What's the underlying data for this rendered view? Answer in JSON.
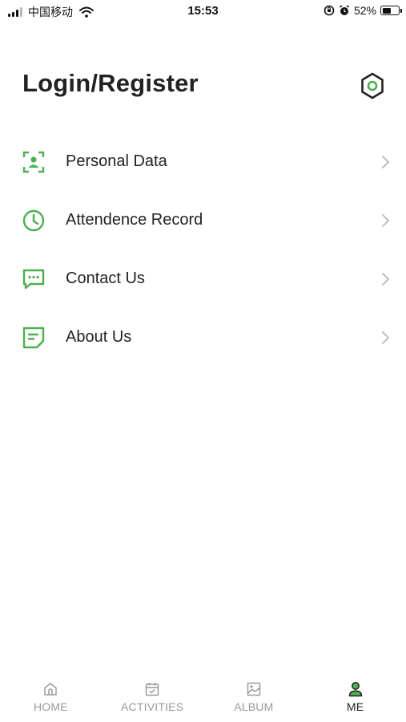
{
  "status_bar": {
    "carrier": "中国移动",
    "time": "15:53",
    "battery": "52%",
    "battery_level": 0.52
  },
  "header": {
    "title": "Login/Register",
    "settings_icon": "gear-icon"
  },
  "menu": {
    "items": [
      {
        "label": "Personal Data",
        "icon": "user-card-icon"
      },
      {
        "label": "Attendence Record",
        "icon": "clock-icon"
      },
      {
        "label": "Contact Us",
        "icon": "chat-icon"
      },
      {
        "label": "About Us",
        "icon": "note-icon"
      }
    ]
  },
  "tab_bar": {
    "tabs": [
      {
        "label": "HOME",
        "icon": "home-icon",
        "active": false
      },
      {
        "label": "ACTIVITIES",
        "icon": "calendar-icon",
        "active": false
      },
      {
        "label": "ALBUM",
        "icon": "image-icon",
        "active": false
      },
      {
        "label": "ME",
        "icon": "person-icon",
        "active": true
      }
    ]
  },
  "colors": {
    "accent": "#4caf50",
    "text": "#222222",
    "inactive": "#9a9a9a",
    "chevron": "#b5b5b5"
  }
}
